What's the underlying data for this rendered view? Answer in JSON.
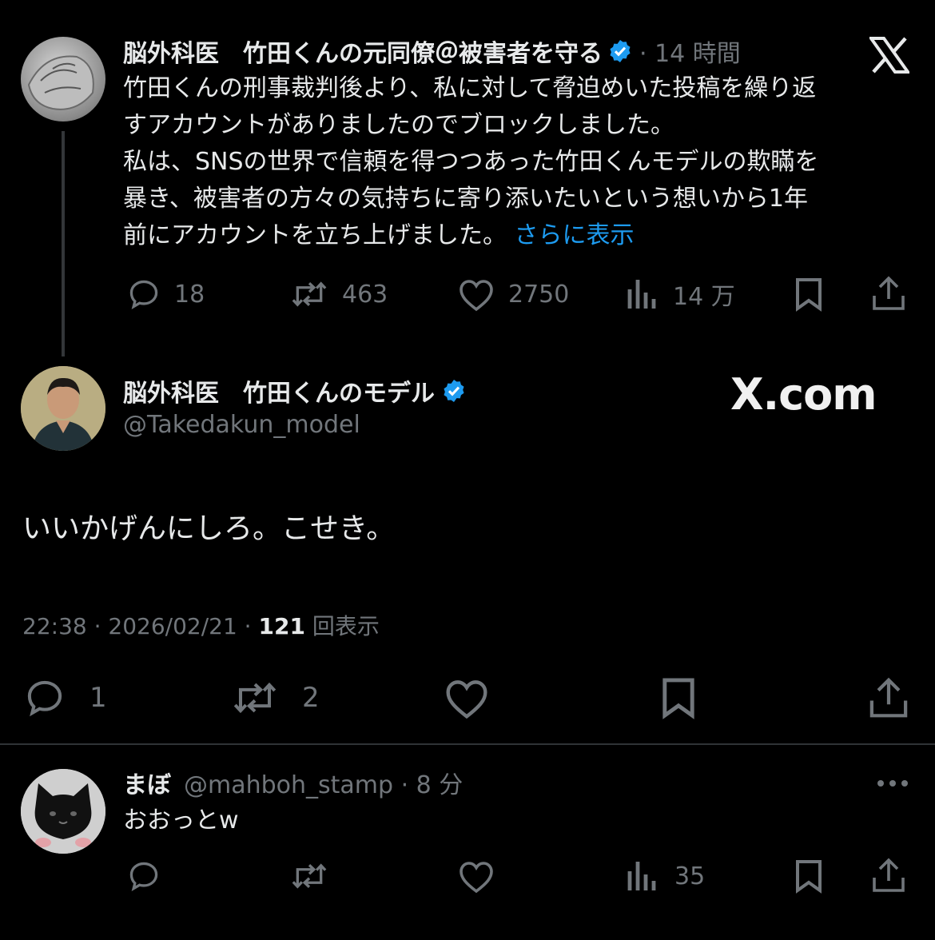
{
  "top_tweet": {
    "author_name": "脳外科医　竹田くんの元同僚＠被害者を守る",
    "time": "· 14 時間",
    "body_lines": [
      "竹田くんの刑事裁判後より、私に対して脅迫めいた投稿を繰り返",
      "すアカウントがありましたのでブロックしました。",
      "私は、SNSの世界で信頼を得つつあった竹田くんモデルの欺瞞を",
      "暴き、被害者の方々の気持ちに寄り添いたいという想いから1年",
      "前にアカウントを立ち上げました。"
    ],
    "show_more": "さらに表示",
    "replies": "18",
    "reposts": "463",
    "likes": "2750",
    "views": "14 万"
  },
  "main_tweet": {
    "author_name": "脳外科医　竹田くんのモデル",
    "handle": "@Takedakun_model",
    "body": "いいかげんにしろ。こせき。",
    "timestamp": "22:38 · 2026/02/21 · ",
    "view_count": "121",
    "view_label": " 回表示",
    "replies": "1",
    "reposts": "2"
  },
  "reply_tweet": {
    "author_name": "まぼ",
    "handle_time": "@mahboh_stamp · 8 分",
    "body": "おおっとw",
    "views": "35"
  },
  "watermark": "X.com",
  "colors": {
    "background": "#000000",
    "text": "#e7e9ea",
    "secondary": "#71767b",
    "accent": "#1d9bf0"
  }
}
